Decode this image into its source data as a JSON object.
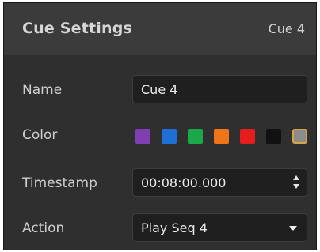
{
  "header": {
    "title": "Cue Settings",
    "cue_label": "Cue 4"
  },
  "fields": {
    "name": {
      "label": "Name",
      "value": "Cue 4"
    },
    "color": {
      "label": "Color",
      "swatches": [
        {
          "name": "purple",
          "hex": "#7f3fb3"
        },
        {
          "name": "blue",
          "hex": "#1f6fd6"
        },
        {
          "name": "green",
          "hex": "#1aa84b"
        },
        {
          "name": "orange",
          "hex": "#f07418"
        },
        {
          "name": "red",
          "hex": "#e51d1d"
        },
        {
          "name": "black",
          "hex": "#111111"
        },
        {
          "name": "gray",
          "hex": "#8c8c8c"
        }
      ],
      "selected_index": 6,
      "selected_border": "#d6a441"
    },
    "timestamp": {
      "label": "Timestamp",
      "value": "00:08:00.000"
    },
    "action": {
      "label": "Action",
      "value": "Play Seq 4"
    }
  }
}
